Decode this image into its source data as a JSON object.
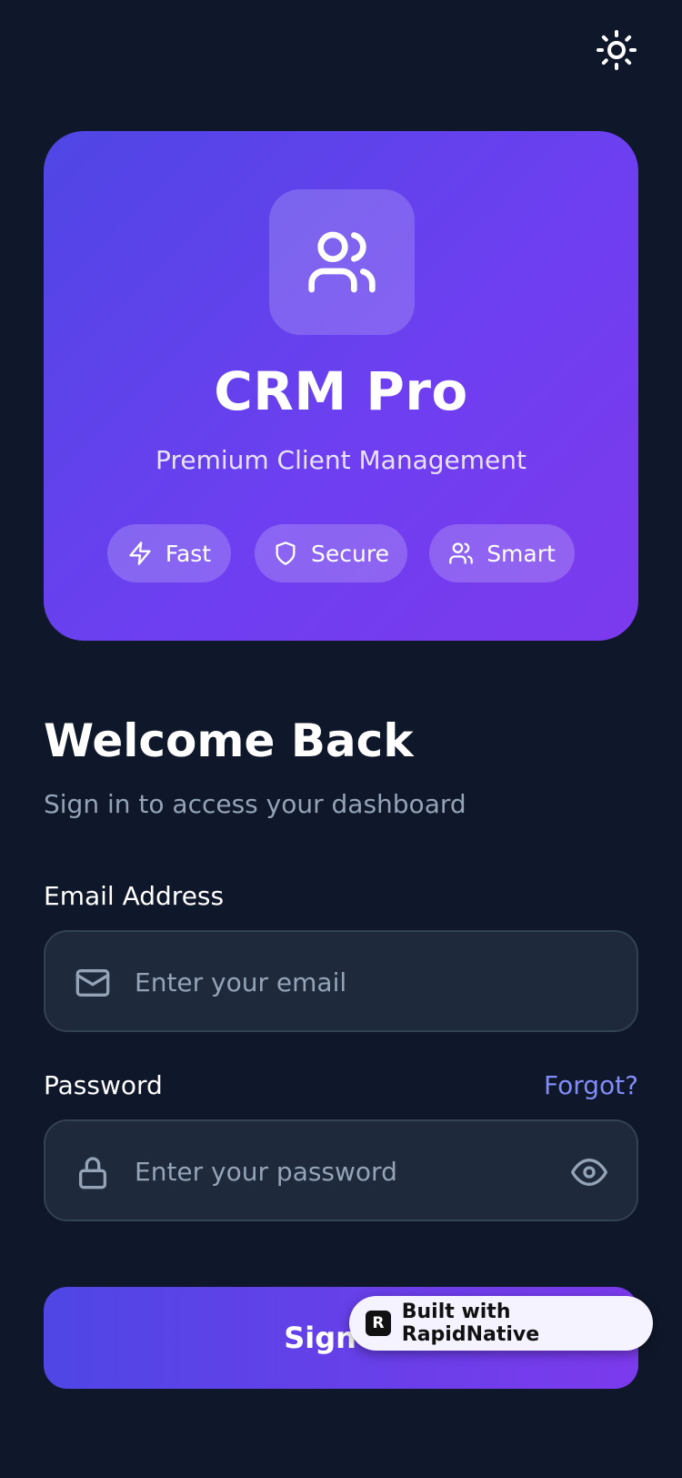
{
  "theme_toggle": {
    "icon": "sun-icon"
  },
  "hero": {
    "logo_icon": "users-icon",
    "title": "CRM Pro",
    "subtitle": "Premium Client Management",
    "pills": [
      {
        "label": "Fast",
        "icon": "zap-icon"
      },
      {
        "label": "Secure",
        "icon": "shield-icon"
      },
      {
        "label": "Smart",
        "icon": "users-icon"
      }
    ]
  },
  "welcome": {
    "title": "Welcome Back",
    "subtitle": "Sign in to access your dashboard"
  },
  "email": {
    "label": "Email Address",
    "placeholder": "Enter your email",
    "icon": "mail-icon"
  },
  "password": {
    "label": "Password",
    "forgot_label": "Forgot?",
    "placeholder": "Enter your password",
    "icon": "lock-icon",
    "toggle_icon": "eye-icon"
  },
  "signin": {
    "label": "Sign In"
  },
  "badge": {
    "label": "Built with RapidNative",
    "logo_letter": "R"
  },
  "colors": {
    "background": "#0f172a",
    "accent_start": "#4f46e5",
    "accent_end": "#7c3aed",
    "link": "#818cf8",
    "input_bg": "#1e293b",
    "muted_text": "#94a3b8"
  }
}
